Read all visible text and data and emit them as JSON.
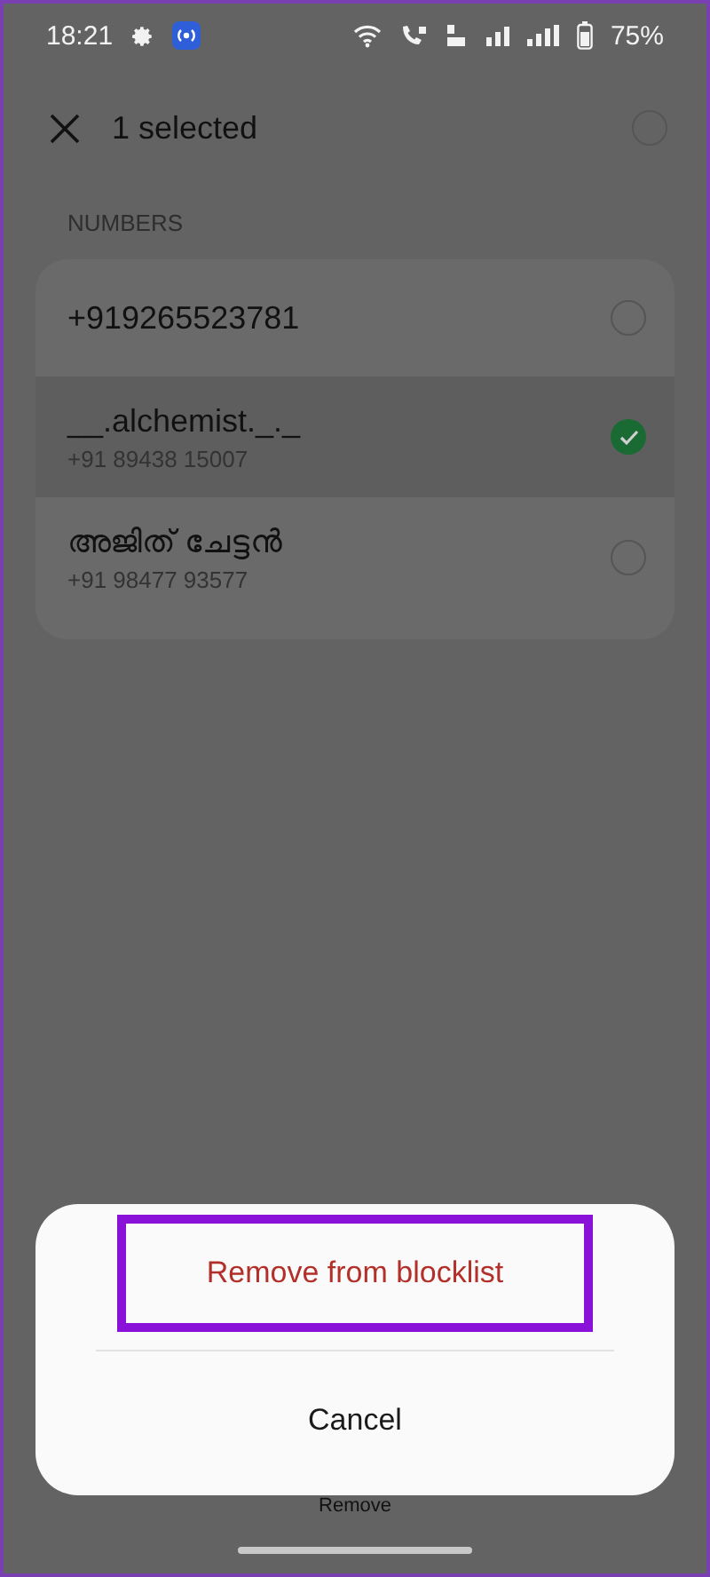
{
  "status_bar": {
    "time": "18:21",
    "battery": "75%"
  },
  "header": {
    "title": "1 selected",
    "select_all_checked": false
  },
  "section_title": "NUMBERS",
  "contacts": [
    {
      "name": "+919265523781",
      "selected": false
    },
    {
      "name": "__.alchemist._._",
      "number": "+91 89438 15007",
      "selected": true
    },
    {
      "name": "അജിത് ചേട്ടൻ",
      "number": "+91 98477 93577",
      "selected": false
    }
  ],
  "bottom_action": "Remove",
  "sheet": {
    "actions": [
      {
        "label": "Remove from blocklist",
        "kind": "destructive",
        "highlighted": true
      },
      {
        "label": "Cancel",
        "kind": "neutral",
        "highlighted": false
      }
    ]
  }
}
